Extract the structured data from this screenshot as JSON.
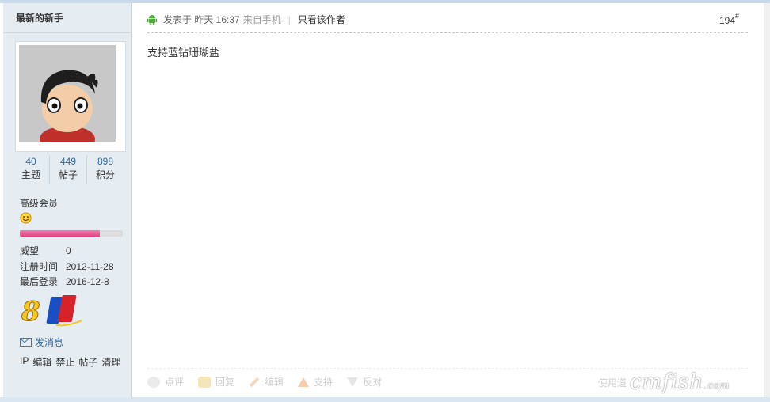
{
  "user": {
    "name": "最新的新手",
    "stats": [
      {
        "value": "40",
        "label": "主题"
      },
      {
        "value": "449",
        "label": "帖子"
      },
      {
        "value": "898",
        "label": "积分"
      }
    ],
    "level": "高级会员",
    "level_progress": 0.78,
    "info": [
      {
        "key": "威望",
        "value": "0"
      },
      {
        "key": "注册时间",
        "value": "2012-11-28"
      },
      {
        "key": "最后登录",
        "value": "2016-12-8"
      }
    ],
    "medal_text": "8",
    "send_message": "发消息",
    "admin_links": [
      "IP",
      "编辑",
      "禁止",
      "帖子",
      "清理"
    ]
  },
  "post": {
    "posted_at": "发表于 昨天 16:37",
    "source": "来自手机",
    "separator": "|",
    "only_author": "只看该作者",
    "floor": "194",
    "floor_mark": "#",
    "content": "支持蓝钻珊瑚盐"
  },
  "actions": [
    {
      "label": "点评",
      "icon": "comment-icon",
      "kind": "rate"
    },
    {
      "label": "回复",
      "icon": "reply-icon",
      "kind": "reply"
    },
    {
      "label": "编辑",
      "icon": "pencil-icon",
      "kind": "edit"
    },
    {
      "label": "支持",
      "icon": "thumb-up-icon",
      "kind": "up"
    },
    {
      "label": "反对",
      "icon": "thumb-down-icon",
      "kind": "down"
    }
  ],
  "use_text": "使用道",
  "watermark": {
    "main": "cmfish",
    "sub": ".com"
  }
}
